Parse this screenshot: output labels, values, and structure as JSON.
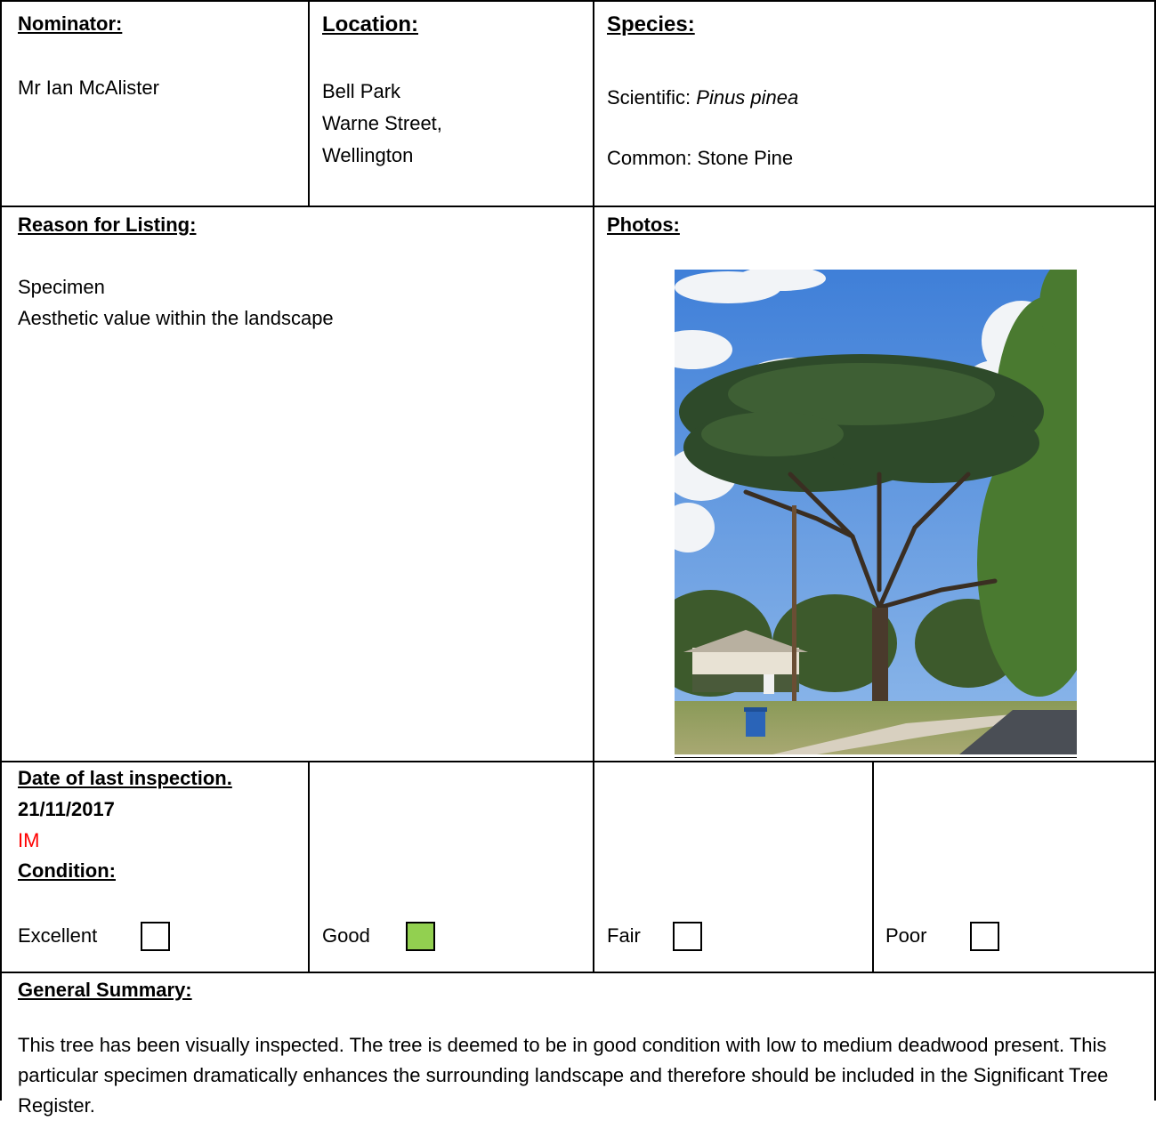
{
  "nominator": {
    "heading": "Nominator:",
    "value": "Mr Ian McAlister"
  },
  "location": {
    "heading": "Location:",
    "line1": "Bell Park",
    "line2": "Warne Street,",
    "line3": "Wellington"
  },
  "species": {
    "heading": "Species:",
    "scientific_label": "Scientific: ",
    "scientific_value": "Pinus pinea",
    "common": "Common: Stone Pine"
  },
  "reason": {
    "heading": "Reason for Listing:",
    "line1": "Specimen",
    "line2": "Aesthetic value within the landscape"
  },
  "photos": {
    "heading": "Photos:"
  },
  "inspection": {
    "heading": "Date of last inspection.",
    "date": "21/11/2017",
    "inspector": "IM",
    "condition_heading": "Condition:"
  },
  "condition": {
    "options": [
      {
        "label": "Excellent",
        "selected": false
      },
      {
        "label": "Good",
        "selected": true
      },
      {
        "label": "Fair",
        "selected": false
      },
      {
        "label": "Poor",
        "selected": false
      }
    ],
    "selected_color": "#92d050"
  },
  "summary": {
    "heading": "General Summary:",
    "text": "This tree has been visually inspected. The tree is deemed to be in good condition with low to medium deadwood present. This particular specimen dramatically enhances the surrounding landscape and therefore should be included in the Significant Tree Register."
  }
}
